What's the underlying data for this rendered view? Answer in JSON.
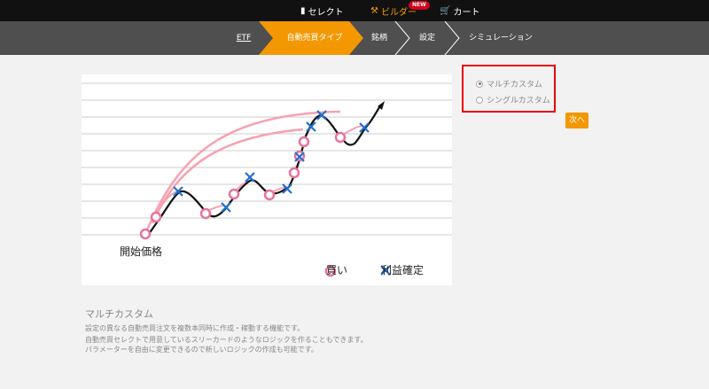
{
  "topnav": {
    "select_label": "セレクト",
    "builder_label": "ビルダー",
    "builder_badge": "NEW",
    "cart_label": "カート",
    "select_icon": "document-icon",
    "builder_icon": "hammer-icon",
    "cart_icon": "cart-icon"
  },
  "steps": [
    {
      "label": "ETF"
    },
    {
      "label": "自動売買タイプ"
    },
    {
      "label": "銘柄"
    },
    {
      "label": "設定"
    },
    {
      "label": "シミュレーション"
    }
  ],
  "chart": {
    "start_label": "開始価格",
    "legend_buy": "買い",
    "legend_take_profit": "利益確定"
  },
  "options": [
    {
      "label": "マルチカスタム",
      "selected": true
    },
    {
      "label": "シングルカスタム",
      "selected": false
    }
  ],
  "next_button": "次へ",
  "description": {
    "title": "マルチカスタム",
    "lines": [
      "設定の異なる自動売買注文を複数本同時に作成・稼動する機能です。",
      "自動売買セレクトで用意しているスリーカードのようなロジックを作ることもできます。",
      "パラメーターを自由に変更できるので新しいロジックの作成も可能です。"
    ]
  },
  "colors": {
    "accent": "#f39800",
    "highlight_border": "#e8000b",
    "buy_marker": "#e8739a",
    "take_marker": "#1f6fd6"
  }
}
